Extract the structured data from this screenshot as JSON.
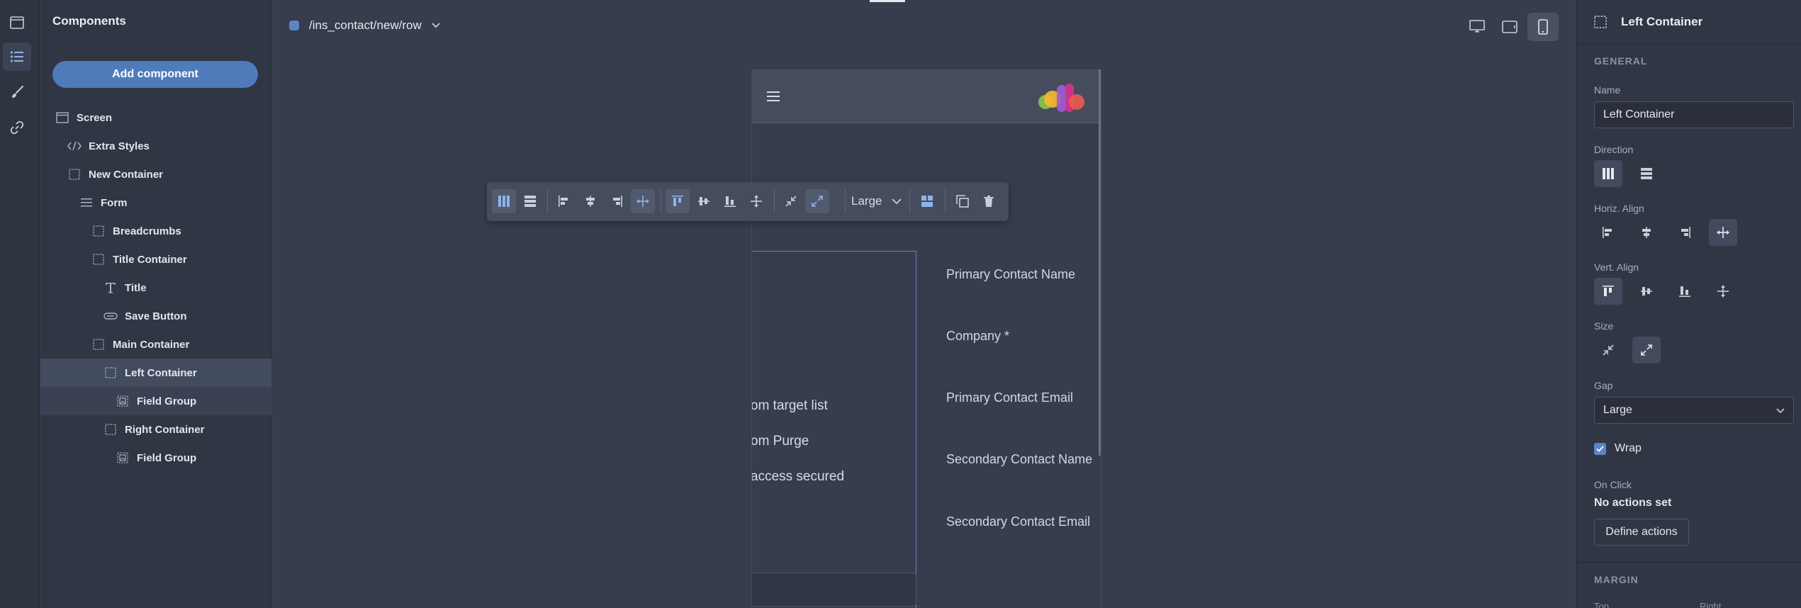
{
  "rail": {
    "items": [
      {
        "icon": "layout-icon"
      },
      {
        "icon": "list-icon"
      },
      {
        "icon": "brush-icon"
      },
      {
        "icon": "link-icon"
      }
    ]
  },
  "components": {
    "title": "Components",
    "add_label": "Add component",
    "tree": [
      {
        "label": "Screen",
        "icon": "screen-icon"
      },
      {
        "label": "Extra Styles",
        "icon": "code-icon"
      },
      {
        "label": "New Container",
        "icon": "container-icon"
      },
      {
        "label": "Form",
        "icon": "form-icon"
      },
      {
        "label": "Breadcrumbs",
        "icon": "container-icon"
      },
      {
        "label": "Title Container",
        "icon": "container-icon"
      },
      {
        "label": "Title",
        "icon": "text-icon"
      },
      {
        "label": "Save Button",
        "icon": "button-icon"
      },
      {
        "label": "Main Container",
        "icon": "container-icon"
      },
      {
        "label": "Left Container",
        "icon": "container-icon"
      },
      {
        "label": "Field Group",
        "icon": "field-group-icon"
      },
      {
        "label": "Right Container",
        "icon": "container-icon"
      },
      {
        "label": "Field Group",
        "icon": "field-group-icon"
      }
    ]
  },
  "canvas": {
    "route": "/ins_contact/new/row",
    "devices": [
      {
        "icon": "desktop-icon"
      },
      {
        "icon": "tablet-icon"
      },
      {
        "icon": "mobile-icon"
      }
    ]
  },
  "preview": {
    "left_text": [
      "om target list",
      "om Purge",
      "access secured"
    ],
    "field_labels": [
      "Primary Contact Name",
      "Company *",
      "Primary Contact Email",
      "Secondary Contact Name",
      "Secondary Contact Email"
    ],
    "logo_colors": [
      "#f5b72c",
      "#8bc34a",
      "#e95a4f",
      "#d6338f",
      "#9e5bd1"
    ]
  },
  "toolbar": {
    "gap_value": "Large"
  },
  "inspector": {
    "title": "Left Container",
    "general_label": "GENERAL",
    "name_label": "Name",
    "name_value": "Left Container",
    "direction_label": "Direction",
    "horiz_label": "Horiz. Align",
    "vert_label": "Vert. Align",
    "size_label": "Size",
    "gap_label": "Gap",
    "gap_value": "Large",
    "wrap_label": "Wrap",
    "onclick_label": "On Click",
    "no_actions": "No actions set",
    "define_actions": "Define actions",
    "margin_label": "MARGIN",
    "top_label": "Top",
    "right_label": "Right"
  },
  "colors": {
    "accent": "#4f7bbb",
    "background": "#373d4c",
    "panel": "#313644"
  }
}
